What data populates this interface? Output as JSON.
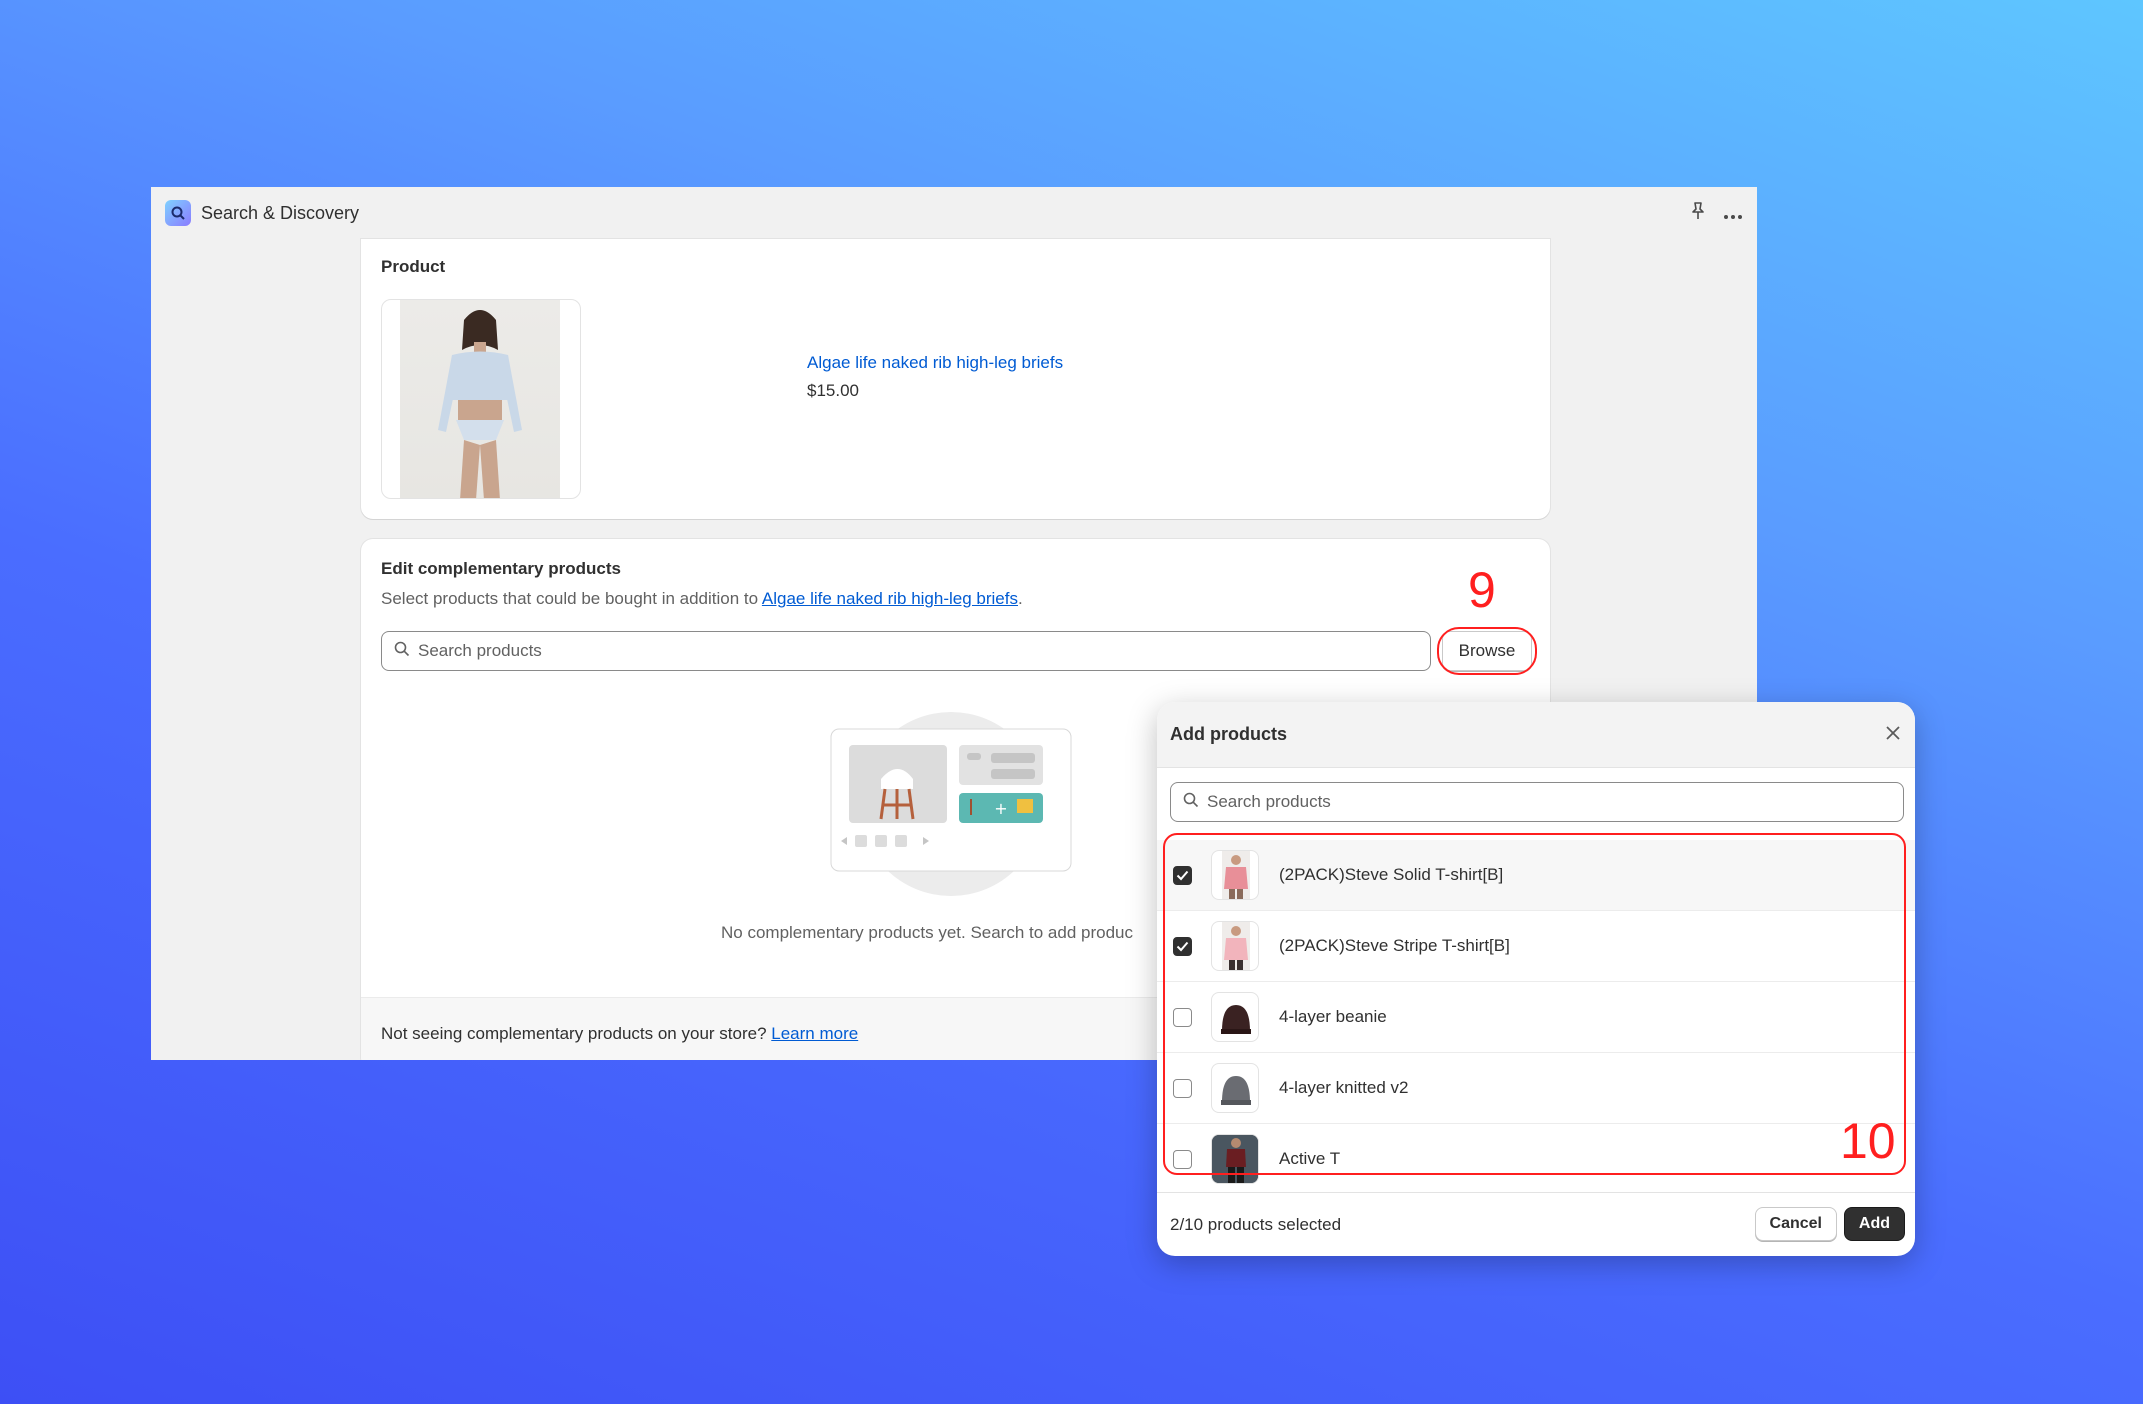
{
  "window": {
    "app_title": "Search & Discovery",
    "pin_icon": "pin-icon",
    "more_icon": "more-icon"
  },
  "product_card": {
    "heading": "Product",
    "name": "Algae life naked rib high-leg briefs",
    "price": "$15.00"
  },
  "complementary": {
    "heading": "Edit complementary products",
    "subtitle_prefix": "Select products that could be bought in addition to ",
    "subtitle_link": "Algae life naked rib high-leg briefs",
    "subtitle_suffix": ".",
    "search_placeholder": "Search products",
    "browse_label": "Browse",
    "empty_text": "No complementary products yet. Search to add produc",
    "footer_text": "Not seeing complementary products on your store? ",
    "footer_link": "Learn more"
  },
  "annotations": {
    "step_9": "9",
    "step_10": "10",
    "color": "#ff1f1f"
  },
  "modal": {
    "title": "Add products",
    "search_placeholder": "Search products",
    "items": [
      {
        "label": "(2PACK)Steve Solid T-shirt[B]",
        "checked": true
      },
      {
        "label": "(2PACK)Steve Stripe T-shirt[B]",
        "checked": true
      },
      {
        "label": "4-layer beanie",
        "checked": false
      },
      {
        "label": "4-layer knitted v2",
        "checked": false
      },
      {
        "label": "Active T",
        "checked": false
      }
    ],
    "selected_count": "2/10 products selected",
    "cancel_label": "Cancel",
    "add_label": "Add"
  }
}
